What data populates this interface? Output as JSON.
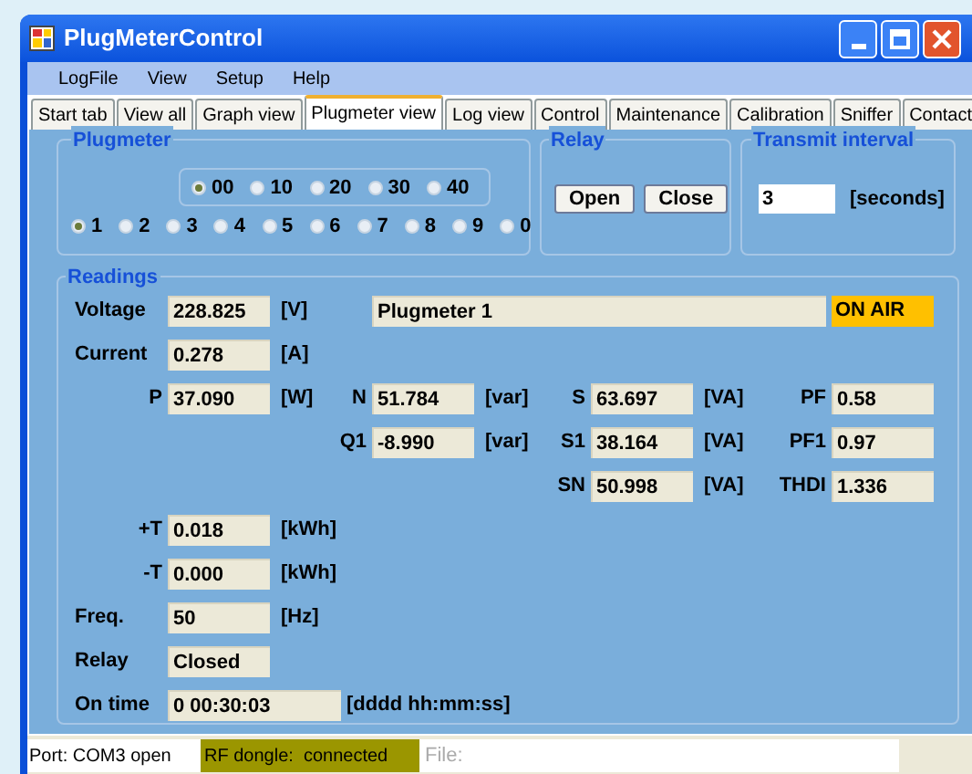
{
  "window": {
    "title": "PlugMeterControl"
  },
  "menu": [
    "LogFile",
    "View",
    "Setup",
    "Help"
  ],
  "tabs": [
    {
      "label": "Start tab",
      "selected": false
    },
    {
      "label": "View all",
      "selected": false
    },
    {
      "label": "Graph view",
      "selected": false
    },
    {
      "label": "Plugmeter view",
      "selected": true
    },
    {
      "label": "Log view",
      "selected": false
    },
    {
      "label": "Control",
      "selected": false
    },
    {
      "label": "Maintenance",
      "selected": false
    },
    {
      "label": "Calibration",
      "selected": false
    },
    {
      "label": "Sniffer",
      "selected": false
    },
    {
      "label": "Contact",
      "selected": false
    }
  ],
  "plugmeter": {
    "title": "Plugmeter",
    "tens": [
      {
        "label": "00",
        "selected": true
      },
      {
        "label": "10",
        "selected": false
      },
      {
        "label": "20",
        "selected": false
      },
      {
        "label": "30",
        "selected": false
      },
      {
        "label": "40",
        "selected": false
      }
    ],
    "units": [
      {
        "label": "1",
        "selected": true
      },
      {
        "label": "2",
        "selected": false
      },
      {
        "label": "3",
        "selected": false
      },
      {
        "label": "4",
        "selected": false
      },
      {
        "label": "5",
        "selected": false
      },
      {
        "label": "6",
        "selected": false
      },
      {
        "label": "7",
        "selected": false
      },
      {
        "label": "8",
        "selected": false
      },
      {
        "label": "9",
        "selected": false
      },
      {
        "label": "0",
        "selected": false
      }
    ]
  },
  "relay": {
    "title": "Relay",
    "buttons": [
      "Open",
      "Close"
    ]
  },
  "transmit_interval": {
    "title": "Transmit interval",
    "value": "3",
    "unit": "[seconds]"
  },
  "readings": {
    "title": "Readings",
    "rows": [
      [
        {
          "kind": "named",
          "label": "Voltage",
          "value": "228.825",
          "unit": "[V]"
        },
        {
          "kind": "name",
          "value": "Plugmeter 1"
        },
        {
          "kind": "status",
          "value": "ON AIR"
        }
      ],
      [
        {
          "kind": "named",
          "label": "Current",
          "value": "0.278",
          "unit": "[A]"
        }
      ],
      [
        {
          "kind": "symbol",
          "label": "P",
          "value": "37.090",
          "unit": "[W]"
        },
        {
          "kind": "symbol",
          "label": "N",
          "value": "51.784",
          "unit": "[var]"
        },
        {
          "kind": "symbol",
          "label": "S",
          "value": "63.697",
          "unit": "[VA]"
        },
        {
          "kind": "symbol",
          "label": "PF",
          "value": "0.58"
        }
      ],
      [
        {
          "kind": "empty"
        },
        {
          "kind": "symbol",
          "label": "Q1",
          "value": "-8.990",
          "unit": "[var]"
        },
        {
          "kind": "symbol",
          "label": "S1",
          "value": "38.164",
          "unit": "[VA]"
        },
        {
          "kind": "symbol",
          "label": "PF1",
          "value": "0.97"
        }
      ],
      [
        {
          "kind": "empty"
        },
        {
          "kind": "empty"
        },
        {
          "kind": "symbol",
          "label": "SN",
          "value": "50.998",
          "unit": "[VA]"
        },
        {
          "kind": "symbol",
          "label": "THDI",
          "value": "1.336"
        }
      ],
      [
        {
          "kind": "symbol",
          "label": "+T",
          "value": "0.018",
          "unit": "[kWh]"
        }
      ],
      [
        {
          "kind": "symbol",
          "label": "-T",
          "value": "0.000",
          "unit": "[kWh]"
        }
      ],
      [
        {
          "kind": "named",
          "label": "Freq.",
          "value": "50",
          "unit": "[Hz]"
        }
      ],
      [
        {
          "kind": "named",
          "label": "Relay",
          "value": "Closed"
        }
      ],
      [
        {
          "kind": "wide",
          "label": "On time",
          "value": "0 00:30:03",
          "unit": "[dddd hh:mm:ss]"
        }
      ]
    ]
  },
  "status_bar": {
    "port": "Port: COM3 open",
    "rf_dongle": {
      "text": "RF dongle:  connected",
      "connected": true
    },
    "file": "File:"
  }
}
